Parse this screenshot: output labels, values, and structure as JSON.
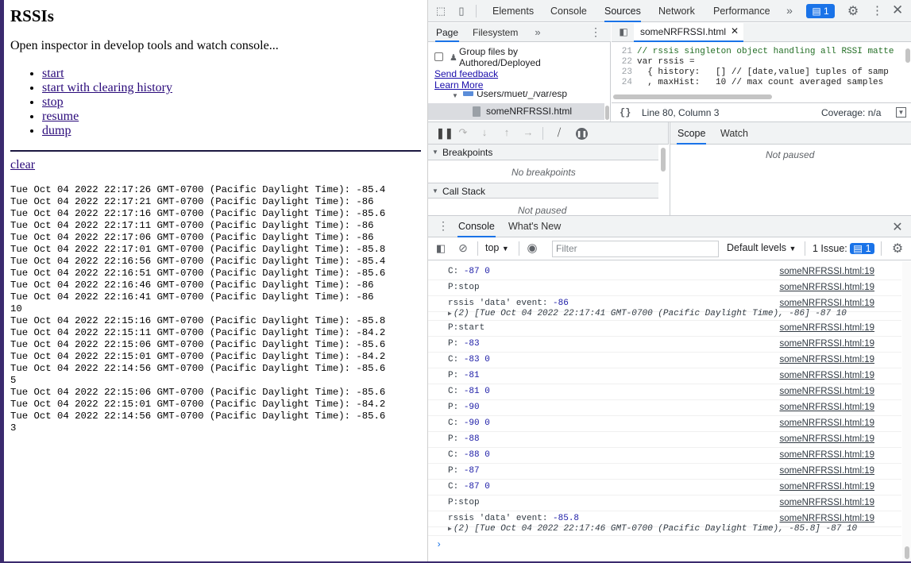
{
  "page": {
    "title": "RSSIs",
    "intro": "Open inspector in develop tools and watch console...",
    "links": [
      "start",
      "start with clearing history",
      "stop",
      "resume",
      "dump"
    ],
    "clear_label": "clear",
    "log_lines": [
      "Tue Oct 04 2022 22:17:26 GMT-0700 (Pacific Daylight Time): -85.4",
      "Tue Oct 04 2022 22:17:21 GMT-0700 (Pacific Daylight Time): -86",
      "Tue Oct 04 2022 22:17:16 GMT-0700 (Pacific Daylight Time): -85.6",
      "Tue Oct 04 2022 22:17:11 GMT-0700 (Pacific Daylight Time): -86",
      "Tue Oct 04 2022 22:17:06 GMT-0700 (Pacific Daylight Time): -86",
      "Tue Oct 04 2022 22:17:01 GMT-0700 (Pacific Daylight Time): -85.8",
      "Tue Oct 04 2022 22:16:56 GMT-0700 (Pacific Daylight Time): -85.4",
      "Tue Oct 04 2022 22:16:51 GMT-0700 (Pacific Daylight Time): -85.6",
      "Tue Oct 04 2022 22:16:46 GMT-0700 (Pacific Daylight Time): -86",
      "Tue Oct 04 2022 22:16:41 GMT-0700 (Pacific Daylight Time): -86",
      "10",
      "Tue Oct 04 2022 22:15:16 GMT-0700 (Pacific Daylight Time): -85.8",
      "Tue Oct 04 2022 22:15:11 GMT-0700 (Pacific Daylight Time): -84.2",
      "Tue Oct 04 2022 22:15:06 GMT-0700 (Pacific Daylight Time): -85.6",
      "Tue Oct 04 2022 22:15:01 GMT-0700 (Pacific Daylight Time): -84.2",
      "Tue Oct 04 2022 22:14:56 GMT-0700 (Pacific Daylight Time): -85.6",
      "5",
      "Tue Oct 04 2022 22:15:06 GMT-0700 (Pacific Daylight Time): -85.6",
      "Tue Oct 04 2022 22:15:01 GMT-0700 (Pacific Daylight Time): -84.2",
      "Tue Oct 04 2022 22:14:56 GMT-0700 (Pacific Daylight Time): -85.6",
      "3"
    ]
  },
  "devtools": {
    "tabs": [
      "Elements",
      "Console",
      "Sources",
      "Network",
      "Performance"
    ],
    "selected_tab": "Sources",
    "issues_count": "1",
    "navigator": {
      "tabs": [
        "Page",
        "Filesystem"
      ],
      "group_label": "Group files by Authored/Deployed",
      "send_feedback": "Send feedback",
      "learn_more": "Learn More",
      "folder": "Users/muet/_/var/esp",
      "file": "someNRFRSSI.html"
    },
    "editor": {
      "tab": "someNRFRSSI.html",
      "lines": [
        {
          "n": "21",
          "text": "// rssis singleton object handling all RSSI matte"
        },
        {
          "n": "22",
          "text": "var rssis ="
        },
        {
          "n": "23",
          "text": "  { history:   [] // [date,value] tuples of samp"
        },
        {
          "n": "24",
          "text": "  , maxHist:   10 // max count averaged samples"
        }
      ],
      "position": "Line 80, Column 3",
      "coverage": "Coverage: n/a"
    },
    "debugger": {
      "breakpoints_label": "Breakpoints",
      "no_breakpoints": "No breakpoints",
      "call_stack_label": "Call Stack",
      "not_paused": "Not paused",
      "scope_tab": "Scope",
      "watch_tab": "Watch"
    },
    "drawer": {
      "tabs": [
        "Console",
        "What's New"
      ],
      "context": "top",
      "filter_placeholder": "Filter",
      "levels": "Default levels",
      "issues_label": "1 Issue:",
      "issues_count": "1",
      "source": "someNRFRSSI.html:19",
      "messages": [
        {
          "text": "C: ",
          "num": "-87 0"
        },
        {
          "text": "P:stop",
          "num": ""
        },
        {
          "text": "rssis 'data' event:  ",
          "num": "-86"
        },
        {
          "obj": "(2) [Tue Oct 04 2022 22:17:41 GMT-0700 (Pacific Daylight Time), -86] -87 10"
        },
        {
          "text": "P:start",
          "num": ""
        },
        {
          "text": "P: ",
          "num": "-83"
        },
        {
          "text": "C: ",
          "num": "-83 0"
        },
        {
          "text": "P: ",
          "num": "-81"
        },
        {
          "text": "C: ",
          "num": "-81 0"
        },
        {
          "text": "P: ",
          "num": "-90"
        },
        {
          "text": "C: ",
          "num": "-90 0"
        },
        {
          "text": "P: ",
          "num": "-88"
        },
        {
          "text": "C: ",
          "num": "-88 0"
        },
        {
          "text": "P: ",
          "num": "-87"
        },
        {
          "text": "C: ",
          "num": "-87 0"
        },
        {
          "text": "P:stop",
          "num": ""
        },
        {
          "text": "rssis 'data' event:  ",
          "num": "-85.8"
        },
        {
          "obj": "(2) [Tue Oct 04 2022 22:17:46 GMT-0700 (Pacific Daylight Time), -85.8] -87 10"
        }
      ]
    }
  }
}
